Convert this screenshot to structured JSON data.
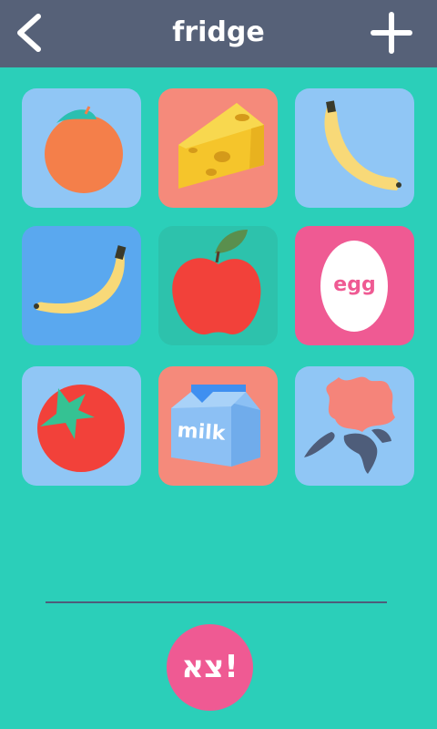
{
  "header": {
    "title": "fridge",
    "back_icon": "chevron-left-icon",
    "add_icon": "plus-icon"
  },
  "items": [
    {
      "name": "orange",
      "bg": "#90c6f5"
    },
    {
      "name": "cheese",
      "bg": "#f58a7b"
    },
    {
      "name": "banana",
      "bg": "#90c6f5"
    },
    {
      "name": "banana",
      "bg": "#5aa8ef"
    },
    {
      "name": "apple",
      "bg": "#2dc2ac"
    },
    {
      "name": "egg",
      "bg": "#ef5a93",
      "label": "egg"
    },
    {
      "name": "tomato",
      "bg": "#90c6f5"
    },
    {
      "name": "milk",
      "bg": "#f58a7b",
      "label": "milk"
    },
    {
      "name": "flower",
      "bg": "#90c6f5"
    }
  ],
  "go_button": {
    "label": "צא!"
  },
  "colors": {
    "background": "#2bcfb9",
    "header": "#566178",
    "divider": "#4e5d7a",
    "go_button": "#ef5a93"
  }
}
